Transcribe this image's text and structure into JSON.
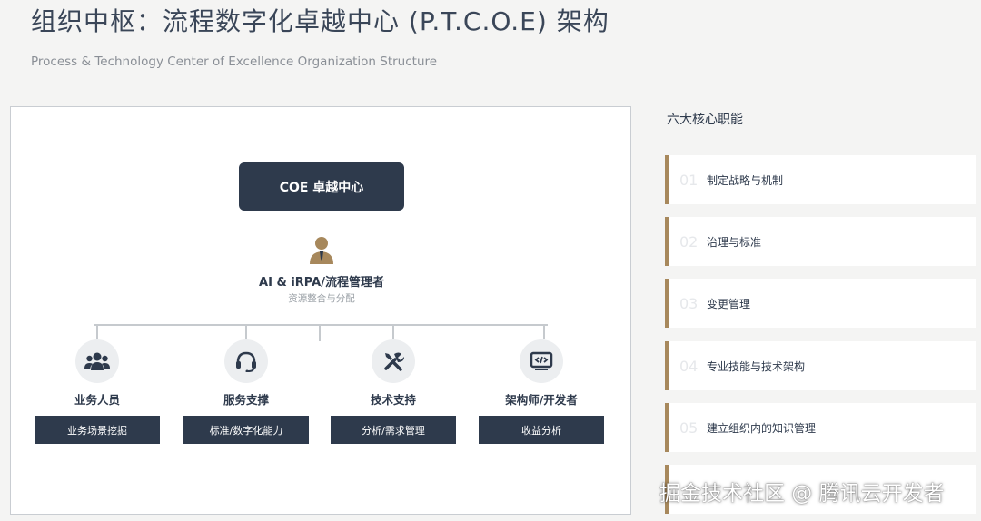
{
  "header": {
    "title": "组织中枢：流程数字化卓越中心 (P.T.C.O.E) 架构",
    "subtitle": "Process & Technology Center of Excellence Organization Structure"
  },
  "diagram": {
    "root": "COE 卓越中心",
    "manager": {
      "icon": "person-icon",
      "name": "AI & iRPA/流程管理者",
      "desc": "资源整合与分配"
    },
    "roles": [
      {
        "icon": "users-icon",
        "name": "业务人员",
        "task": "业务场景挖掘"
      },
      {
        "icon": "headset-icon",
        "name": "服务支撑",
        "task": "标准/数字化能力"
      },
      {
        "icon": "tools-icon",
        "name": "技术支持",
        "task": "分析/需求管理"
      },
      {
        "icon": "code-icon",
        "name": "架构师/开发者",
        "task": "收益分析"
      }
    ]
  },
  "functions": {
    "title": "六大核心职能",
    "items": [
      {
        "num": "01",
        "label": "制定战略与机制"
      },
      {
        "num": "02",
        "label": "治理与标准"
      },
      {
        "num": "03",
        "label": "变更管理"
      },
      {
        "num": "04",
        "label": "专业技能与技术架构"
      },
      {
        "num": "05",
        "label": "建立组织内的知识管理"
      }
    ]
  },
  "watermark": "掘金技术社区 @ 腾讯云开发者",
  "colors": {
    "navy": "#2e3a4c",
    "gold": "#a7885c",
    "background": "#f4f4f3"
  }
}
